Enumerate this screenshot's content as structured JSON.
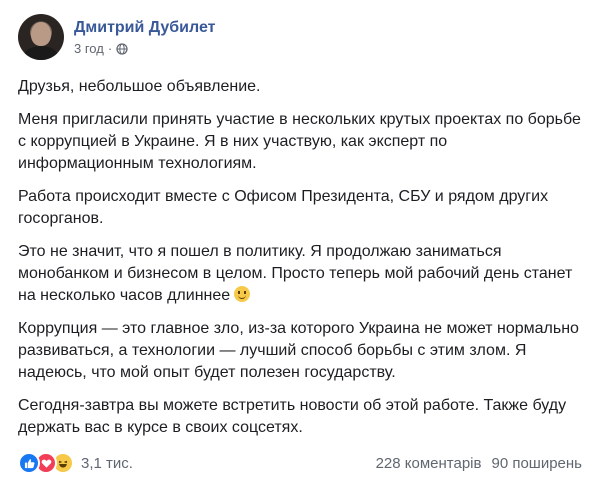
{
  "post": {
    "author": "Дмитрий Дубилет",
    "time": "3 год",
    "dot": "·",
    "paragraphs": [
      "Друзья, небольшое объявление.",
      "Меня пригласили принять участие в нескольких крутых проектах по борьбе с коррупцией в Украине. Я в них участвую, как эксперт по информационным технологиям.",
      "Работа происходит вместе с Офисом Президента, СБУ и рядом других госорганов.",
      "Это не значит, что я пошел в политику. Я продолжаю заниматься монобанком и бизнесом в целом. Просто теперь мой рабочий день станет на несколько часов длиннее",
      "Коррупция — это главное зло, из-за которого Украина не может нормально развиваться, а технологии — лучший способ борьбы с этим злом. Я надеюсь, что мой опыт будет полезен государству.",
      "Сегодня-завтра вы можете встретить новости об этой работе. Также буду держать вас в курсе в своих соцсетях."
    ]
  },
  "footer": {
    "reactions_count": "3,1 тис.",
    "comments": "228 коментарів",
    "shares": "90 поширень"
  },
  "icons": {
    "privacy": "globe-icon",
    "emoji": "smile-emoji-icon",
    "reactions": [
      "like-icon",
      "love-icon",
      "haha-icon"
    ]
  },
  "colors": {
    "author": "#385898",
    "meta": "#616770",
    "like": "#1877f2",
    "love": "#f33e58",
    "haha": "#f7c948"
  }
}
